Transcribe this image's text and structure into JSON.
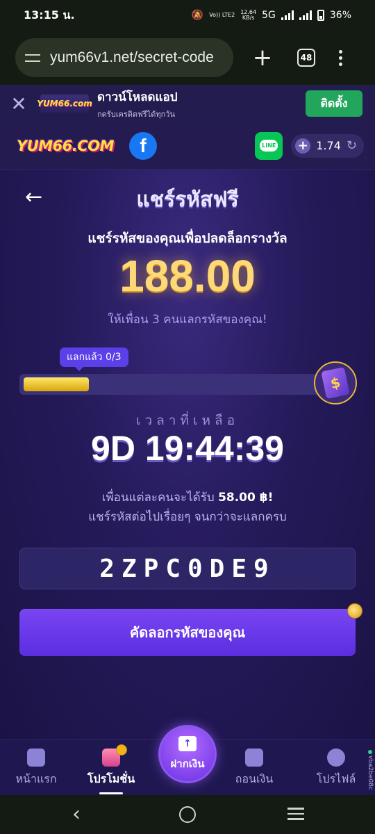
{
  "status_bar": {
    "time": "13:15 น.",
    "network_speed": "12.64",
    "network_unit": "KB/s",
    "volte": "Vo)) LTE2",
    "network": "5G",
    "battery": "36%"
  },
  "browser": {
    "url": "yum66v1.net/secret-code",
    "tab_count": "48"
  },
  "install_banner": {
    "logo_text": "YUM66.com",
    "title": "ดาวน์โหลดแอป",
    "subtitle": "กดรับเครดิตฟรีได้ทุกวัน",
    "install_label": "ติดตั้ง"
  },
  "header": {
    "logo_text": "YUM66.COM",
    "facebook_glyph": "f",
    "line_label": "LINE",
    "balance": "1.74"
  },
  "page": {
    "title": "แชร์รหัสฟรี",
    "subtitle": "แชร์รหัสของคุณเพื่อปลดล็อกรางวัล",
    "amount": "188.00",
    "hint": "ให้เพื่อน 3 คนแลกรหัสของคุณ!",
    "progress_badge": "แลกแล้ว 0/3",
    "progress_fill_fraction": 0.22,
    "timer_label": "เวลาที่เหลือ",
    "timer": "9D 19:44:39",
    "info_prefix": "เพื่อนแต่ละคนจะได้รับ",
    "info_amount": "58.00 ฿!",
    "info_line2": "แชร์รหัสต่อไปเรื่อยๆ จนกว่าจะแลกครบ",
    "code": "2ZPC0DE9",
    "copy_button": "คัดลอกรหัสของคุณ"
  },
  "bottom_nav": {
    "home": "หน้าแรก",
    "promotions": "โปรโมชั่น",
    "deposit": "ฝากเงิน",
    "withdraw": "ถอนเงิน",
    "profile": "โปรไฟล์",
    "version_tag": "vba2be08c"
  },
  "colors": {
    "background": "#1c1446",
    "accent_purple": "#6a35ea",
    "install_green": "#22a65b",
    "amount_gold": "#ffd978"
  }
}
